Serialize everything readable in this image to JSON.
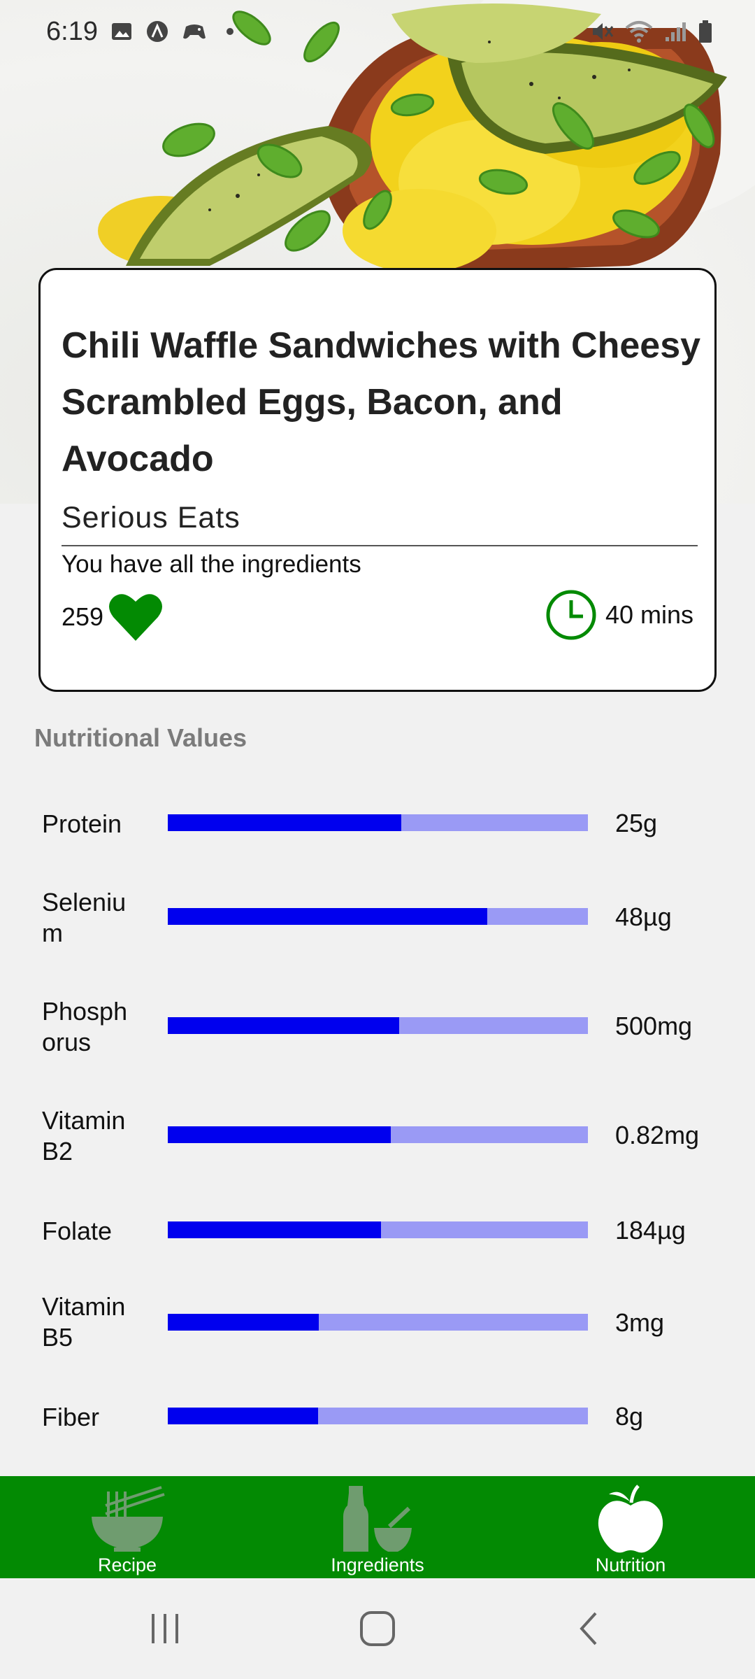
{
  "status_bar": {
    "time": "6:19",
    "left_icons": [
      "gallery-icon",
      "a-icon",
      "game-controller-icon",
      "dot-icon"
    ],
    "right_icons": [
      "mute-icon",
      "wifi-icon",
      "signal-icon",
      "battery-icon"
    ]
  },
  "recipe": {
    "title": "Chili Waffle Sandwiches with Cheesy Scrambled Eggs, Bacon, and Avocado",
    "source": "Serious Eats",
    "ingredients_note": "You have all the ingredients",
    "likes": "259",
    "time": "40 mins"
  },
  "nutrition": {
    "heading": "Nutritional Values",
    "items": [
      {
        "label": "Protein",
        "value": "25g",
        "fraction": 0.555
      },
      {
        "label": "Seleniu m",
        "value": "48µg",
        "fraction": 0.76
      },
      {
        "label": "Phosph orus",
        "value": "500mg",
        "fraction": 0.55
      },
      {
        "label": "Vitamin B2",
        "value": "0.82mg",
        "fraction": 0.53
      },
      {
        "label": "Folate",
        "value": "184µg",
        "fraction": 0.508
      },
      {
        "label": "Vitamin B5",
        "value": "3mg",
        "fraction": 0.36
      },
      {
        "label": "Fiber",
        "value": "8g",
        "fraction": 0.357
      }
    ]
  },
  "bottom_nav": {
    "items": [
      {
        "label": "Recipe",
        "icon": "noodle-bowl-icon"
      },
      {
        "label": "Ingredients",
        "icon": "bottle-mortar-icon"
      },
      {
        "label": "Nutrition",
        "icon": "apple-icon"
      }
    ],
    "active": "Nutrition"
  },
  "colors": {
    "accent_green": "#038a03",
    "bar_fill": "#0000ee",
    "bar_track": "#9a9af5"
  }
}
